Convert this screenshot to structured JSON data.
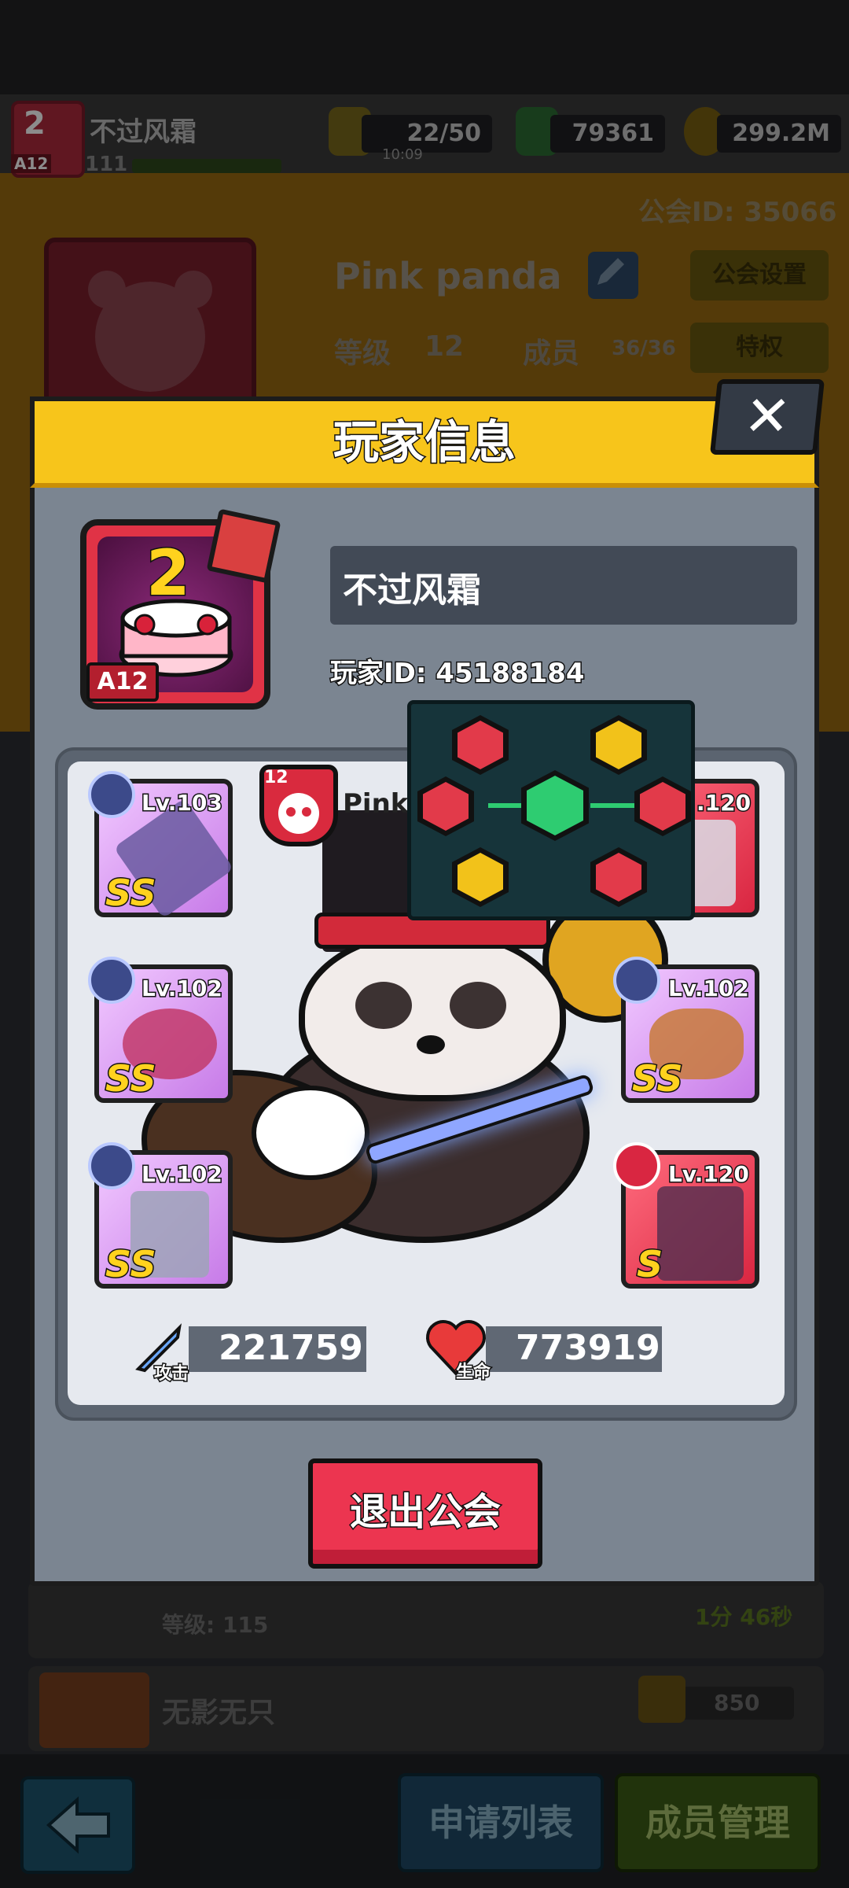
{
  "topbar": {
    "player_name": "不过风霜",
    "player_level": "111",
    "avatar_level": "2",
    "avatar_badge": "A12",
    "energy": "22/50",
    "energy_timer": "10:09",
    "gems": "79361",
    "gold": "299.2M"
  },
  "guild": {
    "id_label": "公会ID: 35066",
    "name": "Pink panda",
    "settings_label": "公会设置",
    "level_label": "等级",
    "level": "12",
    "members_label": "成员",
    "members": "36/36",
    "privilege_label": "特权"
  },
  "member_list": [
    {
      "level_text": "等级: 115",
      "time": "1分 46秒"
    },
    {
      "name": "无影无只",
      "score": "850"
    }
  ],
  "bottom_bar": {
    "back_icon": "arrow-left-icon",
    "apply_list_label": "申请列表",
    "manage_members_label": "成员管理"
  },
  "modal": {
    "title": "玩家信息",
    "close_label": "✕",
    "avatar_level": "2",
    "avatar_badge": "A12",
    "player_name": "不过风霜",
    "player_id": "玩家ID: 45188184",
    "guild_tag_level": "12",
    "guild_tag_name": "Pink",
    "equipment": [
      {
        "slot": "weapon",
        "level": "Lv.103",
        "grade": "SS",
        "rarity": "purple"
      },
      {
        "slot": "necklace",
        "level": "Lv.102",
        "grade": "SS",
        "rarity": "purple"
      },
      {
        "slot": "gloves",
        "level": "Lv.102",
        "grade": "SS",
        "rarity": "purple"
      },
      {
        "slot": "armor",
        "level": ".120",
        "grade": "",
        "rarity": "red"
      },
      {
        "slot": "belt",
        "level": "Lv.102",
        "grade": "SS",
        "rarity": "purple"
      },
      {
        "slot": "boots",
        "level": "Lv.120",
        "grade": "S",
        "rarity": "red"
      }
    ],
    "attack_label": "攻击",
    "attack": "221759",
    "hp_label": "生命",
    "hp": "773919",
    "exit_guild_label": "退出公会"
  },
  "colors": {
    "header_yellow": "#f7c51b",
    "exit_red": "#ec3550",
    "purple_slot": "#c77be8",
    "red_slot": "#d92641",
    "skill_green": "#2ecc71"
  }
}
